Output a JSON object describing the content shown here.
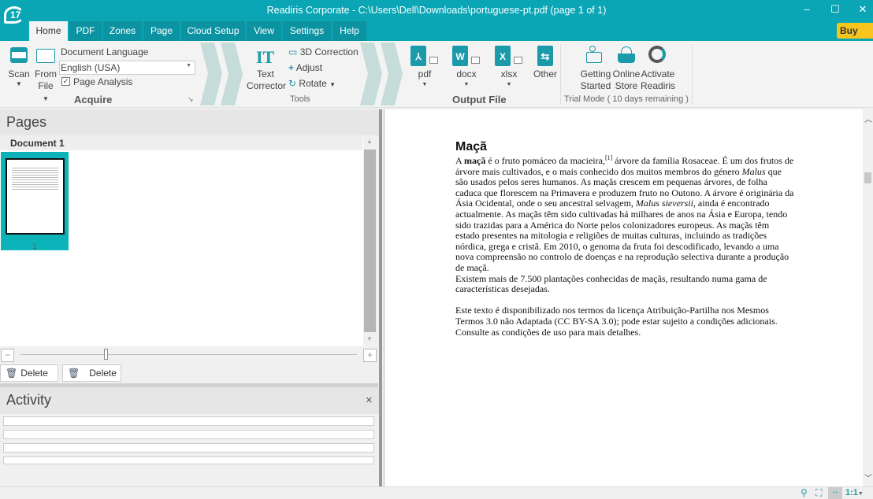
{
  "window": {
    "title": "Readiris Corporate - C:\\Users\\Dell\\Downloads\\portuguese-pt.pdf (page 1 of 1)",
    "logo": "17",
    "minimize": "–",
    "maximize": "☐",
    "close": "✕",
    "buy_now": "Buy now",
    "accent": "#0aa6b6"
  },
  "tabs": [
    {
      "label": "Home",
      "active": true
    },
    {
      "label": "PDF"
    },
    {
      "label": "Zones"
    },
    {
      "label": "Page"
    },
    {
      "label": "Cloud Setup"
    },
    {
      "label": "View"
    },
    {
      "label": "Settings"
    },
    {
      "label": "Help"
    }
  ],
  "ribbon": {
    "acquire": {
      "scan": "Scan",
      "from": "From",
      "file": "File",
      "doc_lang_label": "Document Language",
      "doc_lang_value": "English (USA)",
      "page_analysis": "Page Analysis",
      "page_analysis_checked": true,
      "group": "Acquire"
    },
    "tools": {
      "text": "Text",
      "corrector": "Corrector",
      "correction_3d": "3D Correction",
      "adjust": "Adjust",
      "rotate": "Rotate",
      "group": "Tools"
    },
    "output": {
      "pdf": "pdf",
      "docx": "docx",
      "xlsx": "xlsx",
      "other": "Other",
      "group": "Output File"
    },
    "trial": {
      "getting": "Getting",
      "started": "Started",
      "online": "Online",
      "store": "Store",
      "activate": "Activate",
      "readiris": "Readiris",
      "group": "Trial Mode ( 10 days remaining )"
    }
  },
  "pages": {
    "title": "Pages",
    "document": "Document 1",
    "thumb_number": "1",
    "delete_all": "Delete All",
    "delete": "Delete"
  },
  "activity": {
    "title": "Activity",
    "close": "×"
  },
  "document": {
    "heading": "Maçã",
    "lines": [
      [
        {
          "t": "A "
        },
        {
          "t": "maçã",
          "s": "b"
        },
        {
          "t": " é o fruto pomáceo da macieira,"
        },
        {
          "t": "[1]",
          "s": "sup"
        },
        {
          "t": " árvore da família Rosaceae. É um dos frutos de"
        }
      ],
      [
        {
          "t": "árvore mais cultivados, e o mais conhecido dos muitos membros do género "
        },
        {
          "t": "Malus",
          "s": "i"
        },
        {
          "t": " que"
        }
      ],
      [
        {
          "t": "são usados pelos seres humanos. As maçãs crescem em pequenas árvores, de folha"
        }
      ],
      [
        {
          "t": "caduca que florescem na Primavera e produzem fruto no Outono. A árvore é originária da"
        }
      ],
      [
        {
          "t": "Ásia Ocidental, onde o seu ancestral selvagem, "
        },
        {
          "t": "Malus sieversii",
          "s": "i"
        },
        {
          "t": ", ainda é encontrado"
        }
      ],
      [
        {
          "t": "actualmente. As maçãs têm sido cultivadas há milhares de anos na Ásia e Europa, tendo"
        }
      ],
      [
        {
          "t": "sido trazidas para a América do Norte pelos colonizadores europeus. As maçãs têm"
        }
      ],
      [
        {
          "t": "estado presentes na mitologia e religiões de muitas culturas, incluindo as tradições"
        }
      ],
      [
        {
          "t": "nórdica, grega e cristã. Em 2010, o genoma da fruta foi descodificado, levando a uma"
        }
      ],
      [
        {
          "t": "nova compreensão no controlo de doenças e na reprodução selectiva durante a produção"
        }
      ],
      [
        {
          "t": "de maçã."
        }
      ],
      [
        {
          "t": "Existem mais de 7.500 plantações conhecidas de maçãs, resultando numa gama de"
        }
      ],
      [
        {
          "t": "características desejadas."
        }
      ],
      [],
      [
        {
          "t": "Este texto é disponibilizado nos termos da licença Atribuição-Partilha nos Mesmos"
        }
      ],
      [
        {
          "t": "Termos 3.0 não Adaptada (CC BY-SA 3.0); pode estar sujeito a condições adicionais."
        }
      ],
      [
        {
          "t": "Consulte as condições de uso para mais detalhes."
        }
      ]
    ]
  },
  "statusbar": {
    "zoom_ratio": "1:1"
  }
}
